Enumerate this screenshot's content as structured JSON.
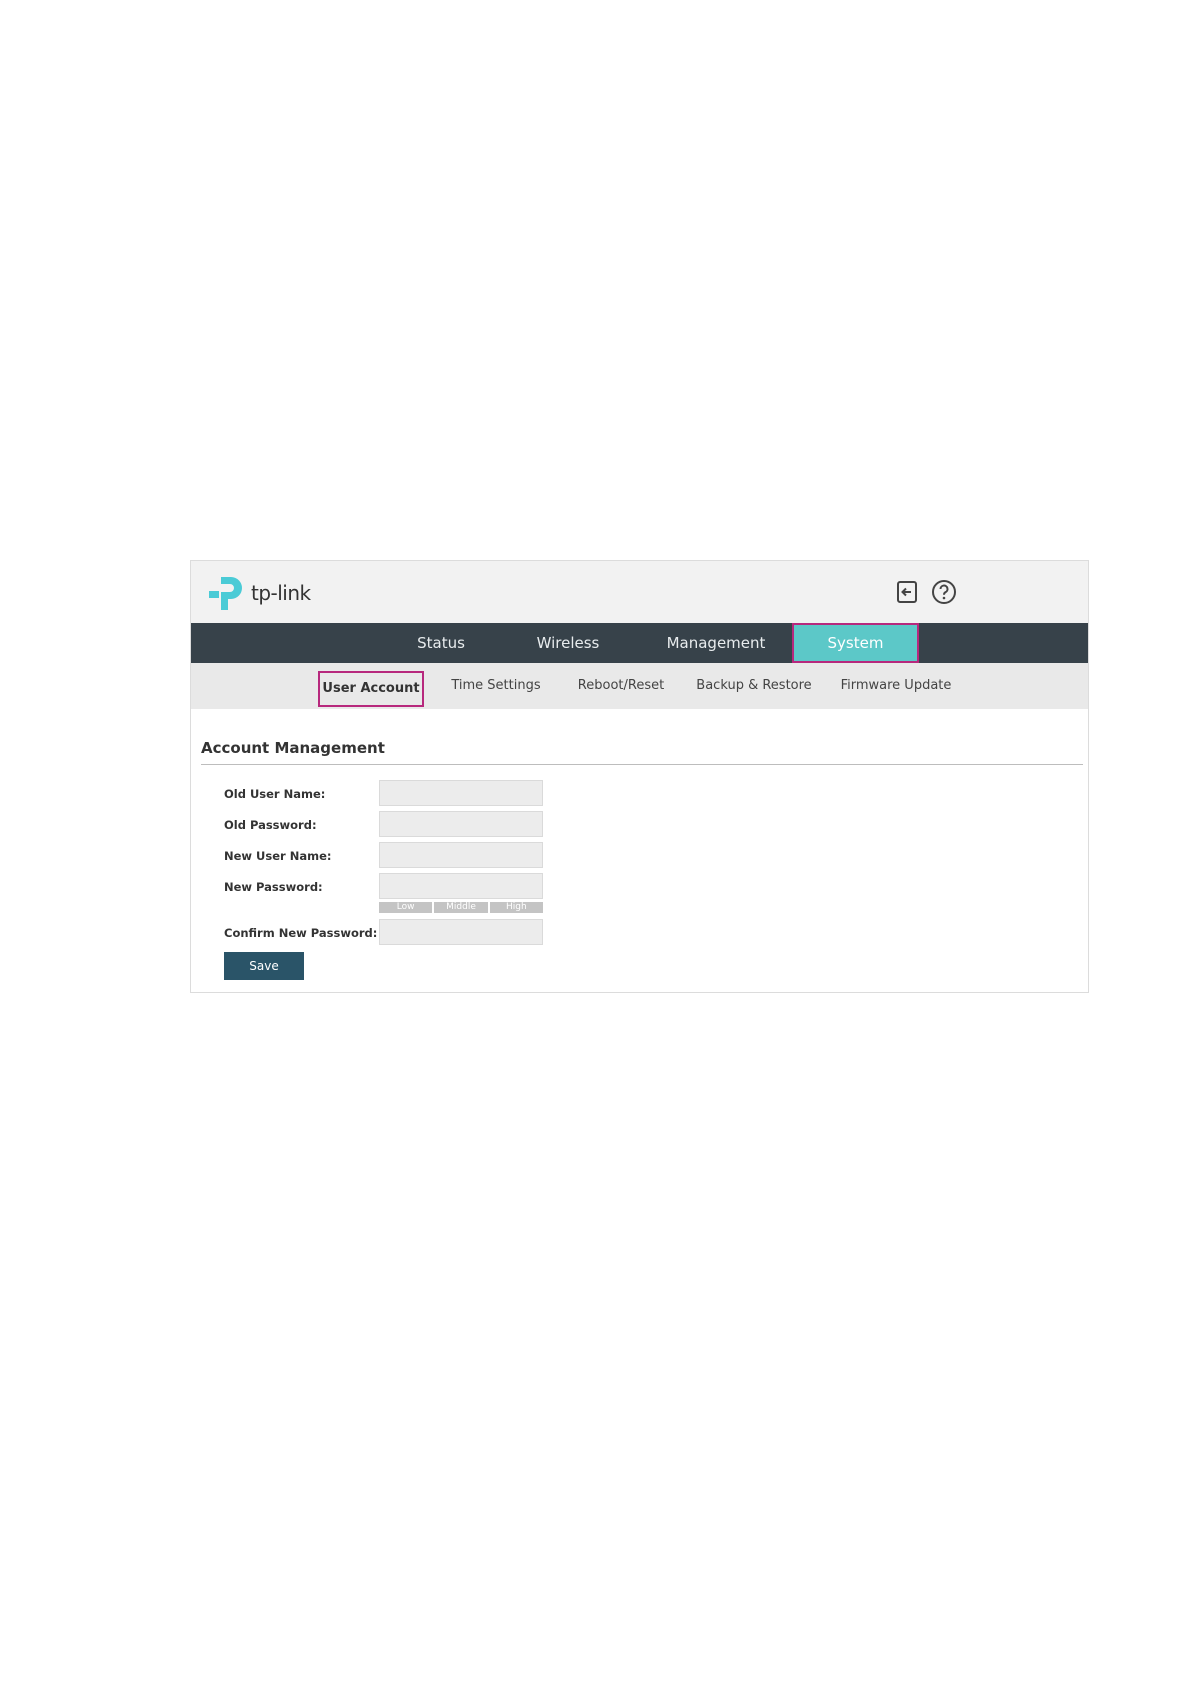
{
  "header": {
    "brand": "tp-link",
    "icons": [
      "logout-icon",
      "help-icon"
    ]
  },
  "main_nav": {
    "items": [
      {
        "label": "Status",
        "active": false
      },
      {
        "label": "Wireless",
        "active": false
      },
      {
        "label": "Management",
        "active": false
      },
      {
        "label": "System",
        "active": true
      }
    ]
  },
  "sub_nav": {
    "items": [
      {
        "label": "User Account",
        "active": true
      },
      {
        "label": "Time Settings",
        "active": false
      },
      {
        "label": "Reboot/Reset",
        "active": false
      },
      {
        "label": "Backup & Restore",
        "active": false
      },
      {
        "label": "Firmware Update",
        "active": false
      }
    ]
  },
  "form": {
    "title": "Account Management",
    "fields": [
      {
        "label": "Old User Name:",
        "value": ""
      },
      {
        "label": "Old Password:",
        "value": ""
      },
      {
        "label": "New User Name:",
        "value": ""
      },
      {
        "label": "New Password:",
        "value": ""
      },
      {
        "label": "Confirm New Password:",
        "value": ""
      }
    ],
    "strength": [
      "Low",
      "Middle",
      "High"
    ],
    "save_label": "Save"
  },
  "colors": {
    "nav_bg": "#37424a",
    "active_tab": "#5cc8c8",
    "highlight_border": "#b7287d",
    "save_button": "#2a5468",
    "brand": "#4acbd6"
  }
}
